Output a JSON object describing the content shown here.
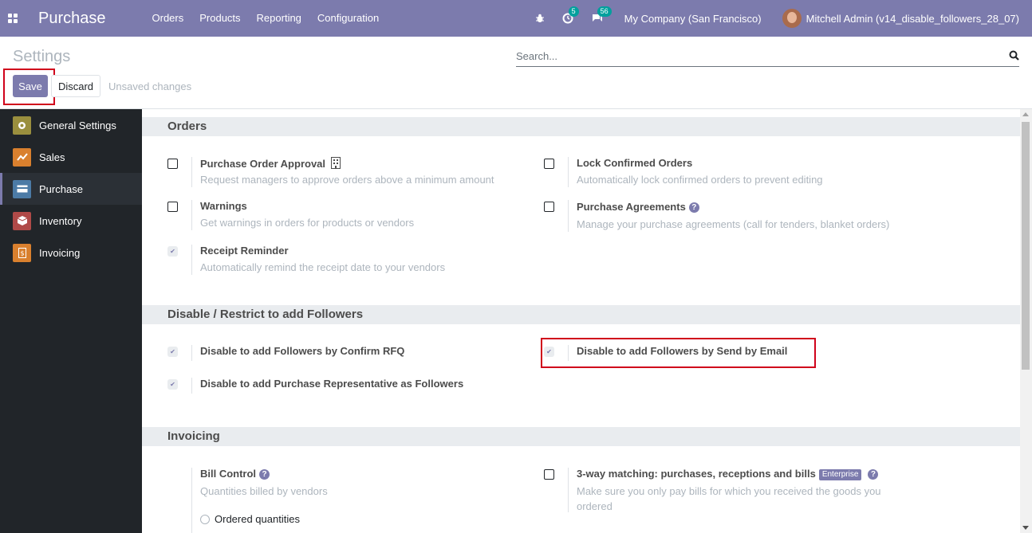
{
  "navbar": {
    "brand": "Purchase",
    "menu": [
      "Orders",
      "Products",
      "Reporting",
      "Configuration"
    ],
    "activity_count": "5",
    "messages_count": "56",
    "company": "My Company (San Francisco)",
    "user": "Mitchell Admin (v14_disable_followers_28_07)"
  },
  "control_panel": {
    "title": "Settings",
    "search_placeholder": "Search...",
    "save_label": "Save",
    "discard_label": "Discard",
    "unsaved_text": "Unsaved changes"
  },
  "sidebar": {
    "items": [
      {
        "label": "General Settings",
        "icon": "gear-icon",
        "color": "#9a8f3e"
      },
      {
        "label": "Sales",
        "icon": "chart-icon",
        "color": "#d9802e"
      },
      {
        "label": "Purchase",
        "icon": "card-icon",
        "color": "#4c7ba6"
      },
      {
        "label": "Inventory",
        "icon": "box-icon",
        "color": "#b04a48"
      },
      {
        "label": "Invoicing",
        "icon": "invoice-icon",
        "color": "#d9802e"
      }
    ]
  },
  "sections": {
    "orders": {
      "title": "Orders",
      "purchase_order_approval": {
        "label": "Purchase Order Approval",
        "desc": "Request managers to approve orders above a minimum amount",
        "checked": false
      },
      "lock_confirmed_orders": {
        "label": "Lock Confirmed Orders",
        "desc": "Automatically lock confirmed orders to prevent editing",
        "checked": false
      },
      "warnings": {
        "label": "Warnings",
        "desc": "Get warnings in orders for products or vendors",
        "checked": false
      },
      "purchase_agreements": {
        "label": "Purchase Agreements",
        "desc": "Manage your purchase agreements (call for tenders, blanket orders)",
        "checked": false
      },
      "receipt_reminder": {
        "label": "Receipt Reminder",
        "desc": "Automatically remind the receipt date to your vendors",
        "checked": true
      }
    },
    "followers": {
      "title": "Disable / Restrict to add Followers",
      "confirm_rfq": {
        "label": "Disable to add Followers by Confirm RFQ",
        "checked": true
      },
      "send_by_email": {
        "label": "Disable to add Followers by Send by Email",
        "checked": true
      },
      "purchase_rep": {
        "label": "Disable to add Purchase Representative as Followers",
        "checked": true
      }
    },
    "invoicing": {
      "title": "Invoicing",
      "bill_control": {
        "label": "Bill Control",
        "desc": "Quantities billed by vendors"
      },
      "three_way": {
        "label": "3-way matching: purchases, receptions and bills",
        "badge": "Enterprise",
        "desc": "Make sure you only pay bills for which you received the goods you ordered",
        "checked": false
      },
      "radio_ordered": "Ordered quantities"
    }
  },
  "colors": {
    "brand": "#7c7bad",
    "sidebar_bg": "#212529",
    "highlight": "#d0021b"
  }
}
